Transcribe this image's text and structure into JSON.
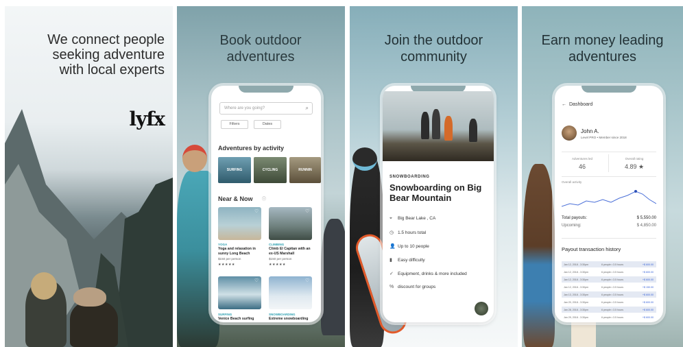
{
  "panels": [
    {
      "headline": "We connect people seeking adventure with local experts",
      "logo": "lyfx"
    },
    {
      "headline": "Book outdoor adventures"
    },
    {
      "headline": "Join the outdoor community"
    },
    {
      "headline": "Earn money leading adventures"
    }
  ],
  "booking": {
    "search_placeholder": "Where are you going?",
    "filters_label": "Filters",
    "dates_label": "Dates",
    "by_activity_title": "Adventures by activity",
    "activities": [
      "SURFING",
      "CYCLING",
      "RUNNIN"
    ],
    "near_now_title": "Near & Now",
    "cards": [
      {
        "tag": "YOGA",
        "title": "Yoga and relaxation in sunny Long Beach",
        "price": "$150 per person",
        "stars": "★★★★★"
      },
      {
        "tag": "CLIMBING",
        "title": "Climb El Capitan with an ex-US Marshall",
        "price": "$150 per person",
        "stars": "★★★★★"
      },
      {
        "tag": "SURFING",
        "title": "Venice Beach surfing",
        "price": "",
        "stars": ""
      },
      {
        "tag": "SNOWBOARDING",
        "title": "Extreme snowboarding",
        "price": "",
        "stars": ""
      }
    ]
  },
  "community": {
    "tag": "SNOWBOARDING",
    "title": "Snowboarding on Big Bear Mountain",
    "features": [
      {
        "icon": "pin-icon",
        "text": "Big Bear Lake , CA"
      },
      {
        "icon": "clock-icon",
        "text": "1.5 hours total"
      },
      {
        "icon": "person-icon",
        "text": "Up to 10 people"
      },
      {
        "icon": "chart-icon",
        "text": "Easy difficulty"
      },
      {
        "icon": "check-icon",
        "text": "Equipment, drinks & more included"
      },
      {
        "icon": "percent-icon",
        "text": "discount for groups"
      }
    ]
  },
  "dashboard": {
    "title": "Dashboard",
    "name": "John A.",
    "level": "Level PRO • Member since 2018",
    "adventures_led_label": "Adventures led",
    "adventures_led": "46",
    "rating_label": "Overall rating",
    "rating": "4.89 ★",
    "activity_label": "Overall activity",
    "total_payouts_label": "Total payouts:",
    "total_payouts": "$ 5,550.00",
    "upcoming_label": "Upcoming:",
    "upcoming": "$ 4,850.00",
    "history_title": "Payout transaction history",
    "transactions": [
      {
        "date": "Jan 12, 2018 - 3:30pm",
        "people": "6 people • 3.5 hours",
        "amount": "+$ 600.00"
      },
      {
        "date": "Jan 12, 2018 - 3:30pm",
        "people": "6 people • 3.5 hours",
        "amount": "+$ 600.00"
      },
      {
        "date": "Jan 12, 2018 - 3:30pm",
        "people": "6 people • 3.5 hours",
        "amount": "+$ 600.00"
      },
      {
        "date": "Jan 12, 2018 - 3:30pm",
        "people": "6 people • 3.5 hours",
        "amount": "+$ 150.00"
      },
      {
        "date": "Jan 13, 2018 - 3:30pm",
        "people": "6 people • 3.5 hours",
        "amount": "+$ 600.00"
      },
      {
        "date": "Jan 20, 2018 - 3:30pm",
        "people": "6 people • 3.5 hours",
        "amount": "+$ 600.00"
      },
      {
        "date": "Jan 28, 2018 - 3:30pm",
        "people": "6 people • 3.5 hours",
        "amount": "+$ 600.00"
      },
      {
        "date": "Jan 29, 2018 - 3:30pm",
        "people": "6 people • 3.5 hours",
        "amount": "+$ 600.00"
      }
    ]
  },
  "colors": {
    "accent_blue": "#3a64d8",
    "teal": "#2d9fb0",
    "phone_bg": "#ffffff"
  }
}
